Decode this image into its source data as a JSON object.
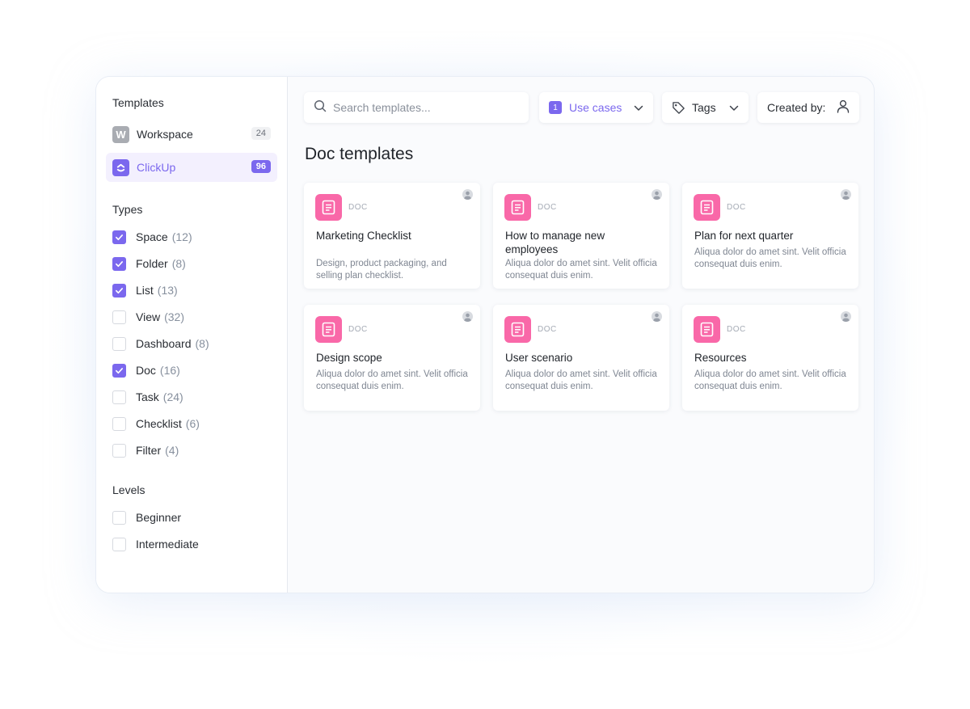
{
  "sidebar": {
    "templates_title": "Templates",
    "sources": [
      {
        "label": "Workspace",
        "count": "24",
        "icon": "W"
      },
      {
        "label": "ClickUp",
        "count": "96"
      }
    ],
    "types_title": "Types",
    "types": [
      {
        "label": "Space",
        "count": "(12)",
        "checked": true
      },
      {
        "label": "Folder",
        "count": "(8)",
        "checked": true
      },
      {
        "label": "List",
        "count": "(13)",
        "checked": true
      },
      {
        "label": "View",
        "count": "(32)",
        "checked": false
      },
      {
        "label": "Dashboard",
        "count": "(8)",
        "checked": false
      },
      {
        "label": "Doc",
        "count": "(16)",
        "checked": true
      },
      {
        "label": "Task",
        "count": "(24)",
        "checked": false
      },
      {
        "label": "Checklist",
        "count": "(6)",
        "checked": false
      },
      {
        "label": "Filter",
        "count": "(4)",
        "checked": false
      }
    ],
    "levels_title": "Levels",
    "levels": [
      {
        "label": "Beginner",
        "checked": false
      },
      {
        "label": "Intermediate",
        "checked": false
      }
    ]
  },
  "toolbar": {
    "search_placeholder": "Search templates...",
    "use_cases_badge": "1",
    "use_cases_label": "Use cases",
    "tags_label": "Tags",
    "created_by_label": "Created by:"
  },
  "main": {
    "title": "Doc templates",
    "cards": [
      {
        "tag": "DOC",
        "title": "Marketing Checklist",
        "desc": "Design, product packaging, and selling plan checklist."
      },
      {
        "tag": "DOC",
        "title": "How to manage new employees",
        "desc": "Aliqua dolor do amet sint. Velit officia consequat duis enim."
      },
      {
        "tag": "DOC",
        "title": "Plan for next quarter",
        "desc": "Aliqua dolor do amet sint. Velit officia consequat duis enim."
      },
      {
        "tag": "DOC",
        "title": "Design scope",
        "desc": "Aliqua dolor do amet sint. Velit officia consequat duis enim."
      },
      {
        "tag": "DOC",
        "title": "User scenario",
        "desc": "Aliqua dolor do amet sint. Velit officia consequat duis enim."
      },
      {
        "tag": "DOC",
        "title": "Resources",
        "desc": "Aliqua dolor do amet sint. Velit officia consequat duis enim."
      }
    ]
  },
  "colors": {
    "accent": "#7b68ee",
    "doc_icon": "#f968a8",
    "sidebar_active_bg": "#f3f0fe"
  },
  "icons": {
    "search": "search-icon",
    "tag": "tag-icon",
    "user": "user-icon",
    "chevron": "chevron-down-icon",
    "doc": "doc-icon",
    "clickup": "clickup-logo-icon",
    "check": "checkmark-icon"
  }
}
